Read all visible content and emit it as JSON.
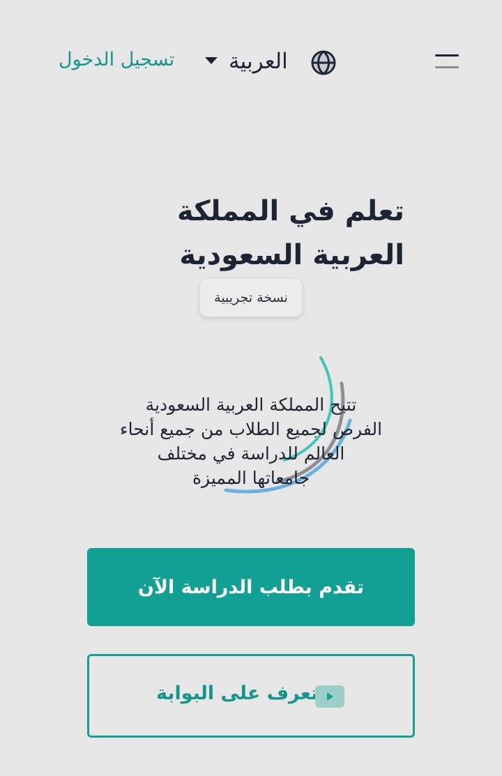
{
  "header": {
    "login_label": "تسجيل الدخول",
    "language_label": "العربية"
  },
  "hero": {
    "title_line1": "تعلم في المملكة",
    "title_line2": "العربية السعودية",
    "badge": "نسخة تجريبية",
    "description_lines": [
      "تتيح المملكة العربية السعودية",
      "الفرص لجميع الطلاب من جميع أنحاء",
      "العالم للدراسة في مختلف",
      "جامعاتها المميزة"
    ]
  },
  "actions": {
    "apply_label": "تقدم بطلب الدراسة الآن",
    "portal_label": "تعرف على البوابة"
  },
  "colors": {
    "accent": "#12a094",
    "text": "#1d2433",
    "background": "#e6e6e6"
  },
  "icons": {
    "menu": "hamburger-menu-icon",
    "language": "globe-icon",
    "dropdown": "caret-down-icon",
    "video": "play-icon"
  }
}
